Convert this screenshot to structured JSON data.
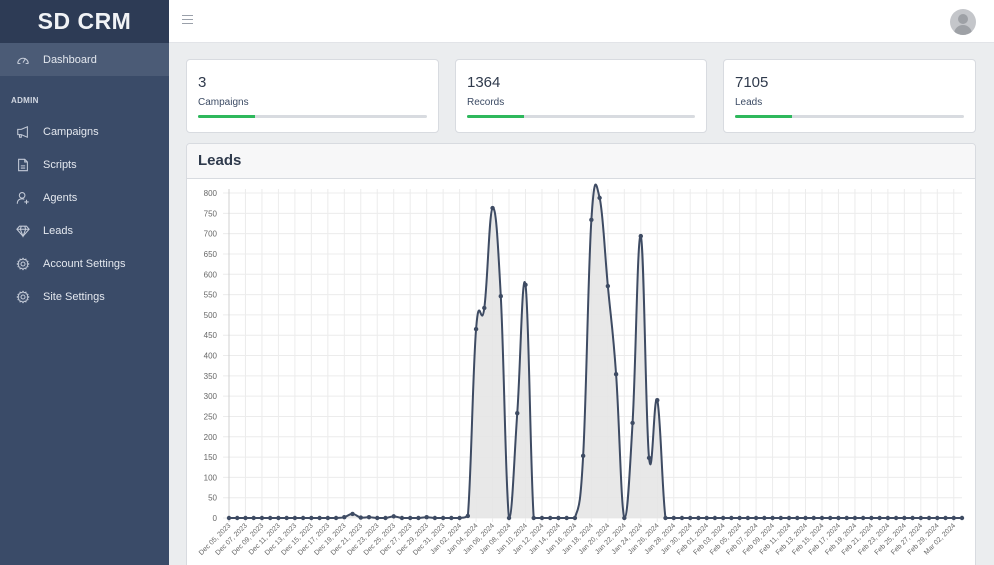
{
  "app": {
    "brand": "SD CRM"
  },
  "sidebar": {
    "items_top": [
      {
        "label": "Dashboard",
        "icon": "speedometer-icon",
        "active": true
      }
    ],
    "section_title": "ADMIN",
    "items": [
      {
        "label": "Campaigns",
        "icon": "megaphone-icon"
      },
      {
        "label": "Scripts",
        "icon": "document-icon"
      },
      {
        "label": "Agents",
        "icon": "user-plus-icon"
      },
      {
        "label": "Leads",
        "icon": "diamond-icon"
      },
      {
        "label": "Account Settings",
        "icon": "gear-icon"
      },
      {
        "label": "Site Settings",
        "icon": "gear-icon"
      }
    ]
  },
  "header": {
    "menu_icon": "hamburger-icon",
    "avatar_icon": "user-avatar-icon"
  },
  "stats": [
    {
      "value": "3",
      "label": "Campaigns",
      "progress_percent": 25,
      "color": "#2eb85c"
    },
    {
      "value": "1364",
      "label": "Records",
      "progress_percent": 25,
      "color": "#2eb85c"
    },
    {
      "value": "7105",
      "label": "Leads",
      "progress_percent": 25,
      "color": "#2eb85c"
    }
  ],
  "chart_panel": {
    "title": "Leads"
  },
  "chart_data": {
    "type": "area",
    "title": "Leads",
    "xlabel": "",
    "ylabel": "",
    "ylim": [
      0,
      800
    ],
    "ytick_step": 50,
    "grid": true,
    "legend": "none",
    "line_color": "#3e4b63",
    "fill_color": "#e5e5e5",
    "start_date": "2023-12-05",
    "x_label_every": 2,
    "x": [
      "Dec 05, 2023",
      "Dec 06, 2023",
      "Dec 07, 2023",
      "Dec 08, 2023",
      "Dec 09, 2023",
      "Dec 10, 2023",
      "Dec 11, 2023",
      "Dec 12, 2023",
      "Dec 13, 2023",
      "Dec 14, 2023",
      "Dec 15, 2023",
      "Dec 16, 2023",
      "Dec 17, 2023",
      "Dec 18, 2023",
      "Dec 19, 2023",
      "Dec 20, 2023",
      "Dec 21, 2023",
      "Dec 22, 2023",
      "Dec 23, 2023",
      "Dec 24, 2023",
      "Dec 25, 2023",
      "Dec 26, 2023",
      "Dec 27, 2023",
      "Dec 28, 2023",
      "Dec 29, 2023",
      "Dec 30, 2023",
      "Dec 31, 2023",
      "Jan 01, 2024",
      "Jan 02, 2024",
      "Jan 03, 2024",
      "Jan 04, 2024",
      "Jan 05, 2024",
      "Jan 06, 2024",
      "Jan 07, 2024",
      "Jan 08, 2024",
      "Jan 09, 2024",
      "Jan 10, 2024",
      "Jan 11, 2024",
      "Jan 12, 2024",
      "Jan 13, 2024",
      "Jan 14, 2024",
      "Jan 15, 2024",
      "Jan 16, 2024",
      "Jan 17, 2024",
      "Jan 18, 2024",
      "Jan 19, 2024",
      "Jan 20, 2024",
      "Jan 21, 2024",
      "Jan 22, 2024",
      "Jan 23, 2024",
      "Jan 24, 2024",
      "Jan 25, 2024",
      "Jan 26, 2024",
      "Jan 27, 2024",
      "Jan 28, 2024",
      "Jan 29, 2024",
      "Jan 30, 2024",
      "Jan 31, 2024",
      "Feb 01, 2024",
      "Feb 02, 2024",
      "Feb 03, 2024",
      "Feb 04, 2024",
      "Feb 05, 2024",
      "Feb 06, 2024",
      "Feb 07, 2024",
      "Feb 08, 2024",
      "Feb 09, 2024",
      "Feb 10, 2024",
      "Feb 11, 2024",
      "Feb 12, 2024",
      "Feb 13, 2024",
      "Feb 14, 2024",
      "Feb 15, 2024",
      "Feb 16, 2024",
      "Feb 17, 2024",
      "Feb 18, 2024",
      "Feb 19, 2024",
      "Feb 20, 2024",
      "Feb 21, 2024",
      "Feb 22, 2024",
      "Feb 23, 2024",
      "Feb 24, 2024",
      "Feb 25, 2024",
      "Feb 26, 2024",
      "Feb 27, 2024",
      "Feb 28, 2024",
      "Feb 29, 2024",
      "Mar 01, 2024",
      "Mar 02, 2024",
      "Mar 03, 2024"
    ],
    "values": [
      0,
      0,
      0,
      0,
      0,
      0,
      0,
      0,
      0,
      0,
      0,
      0,
      0,
      0,
      2,
      10,
      1,
      2,
      0,
      0,
      4,
      0,
      0,
      0,
      2,
      0,
      0,
      0,
      0,
      5,
      465,
      517,
      763,
      546,
      0,
      258,
      574,
      0,
      0,
      0,
      0,
      0,
      0,
      153,
      734,
      788,
      571,
      354,
      0,
      234,
      694,
      148,
      290,
      0,
      0,
      0,
      0,
      0,
      0,
      0,
      0,
      0,
      0,
      0,
      0,
      0,
      0,
      0,
      0,
      0,
      0,
      0,
      0,
      0,
      0,
      0,
      0,
      0,
      0,
      0,
      0,
      0,
      0,
      0,
      0,
      0,
      0,
      0,
      0,
      0
    ]
  }
}
